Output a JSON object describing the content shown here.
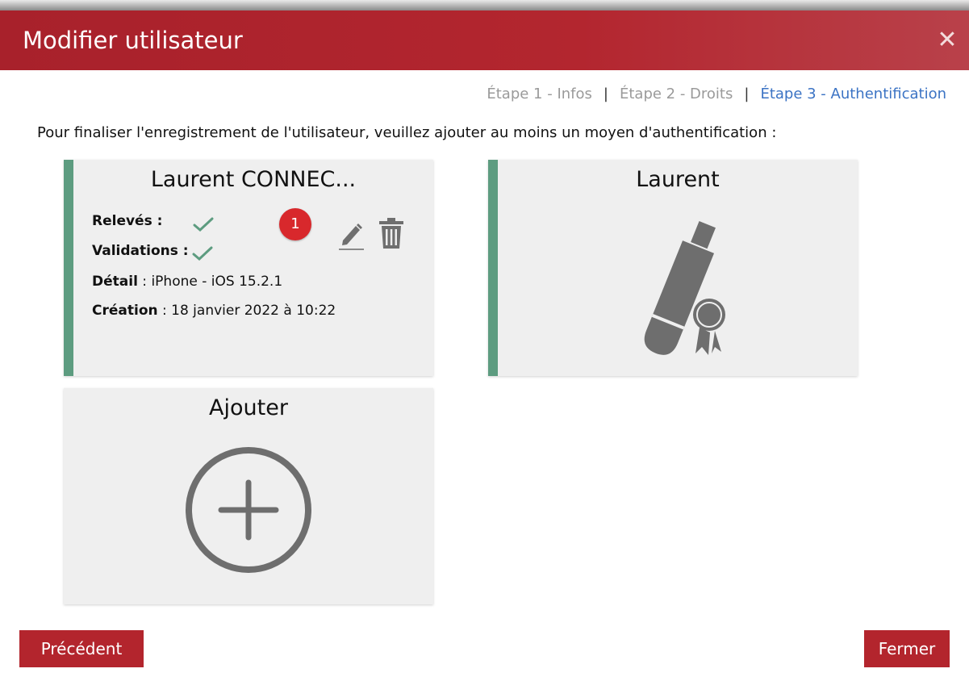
{
  "dialog": {
    "title": "Modifier utilisateur",
    "close_symbol": "✕"
  },
  "steps": [
    {
      "label": "Étape 1 - Infos",
      "active": false
    },
    {
      "label": "Étape 2 - Droits",
      "active": false
    },
    {
      "label": "Étape 3 - Authentification",
      "active": true
    }
  ],
  "step_separator": "|",
  "intro": "Pour finaliser l'enregistrement de l'utilisateur, veuillez ajouter au moins un moyen d'authentification :",
  "cards": {
    "device": {
      "title": "Laurent CONNEC...",
      "releves_label": "Relevés :",
      "validations_label": "Validations :",
      "detail_label": "Détail",
      "detail_value": " : iPhone - iOS 15.2.1",
      "creation_label": "Création",
      "creation_value": " : 18 janvier 2022 à 10:22",
      "badge": "1",
      "icons": [
        "check-icon",
        "pencil-icon",
        "trash-icon"
      ]
    },
    "certificate": {
      "title": "Laurent",
      "icon": "usb-certificate-icon"
    },
    "add": {
      "title": "Ajouter",
      "icon": "plus-circle-icon"
    }
  },
  "buttons": {
    "previous": "Précédent",
    "close": "Fermer"
  },
  "colors": {
    "header": "#b3262f",
    "accent": "#5d9c80",
    "active_step": "#3b73c4",
    "badge": "#d8282c"
  }
}
